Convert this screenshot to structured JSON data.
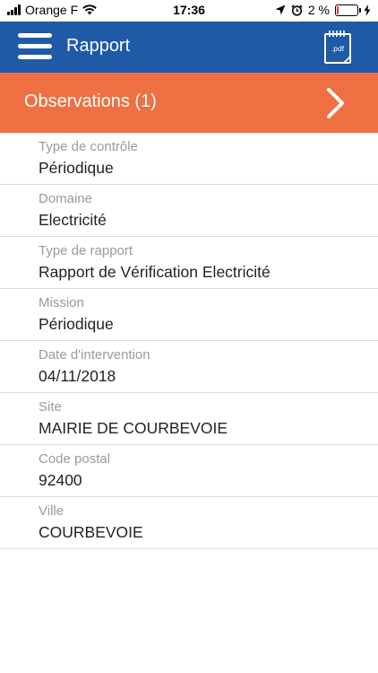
{
  "status_bar": {
    "carrier": "Orange F",
    "time": "17:36",
    "battery_percent": "2 %",
    "battery_level": 0.08,
    "battery_color": "#e53935"
  },
  "header": {
    "title": "Rapport",
    "menu_icon": "hamburger-menu-icon",
    "pdf_icon": "pdf-document-icon",
    "pdf_label": ".pdf",
    "color": "#1f5aa6"
  },
  "observations": {
    "label": "Observations (1)",
    "icon": "chevron-right-icon",
    "color": "#ef7043"
  },
  "details": [
    {
      "label": "Type de contrôle",
      "value": "Périodique"
    },
    {
      "label": "Domaine",
      "value": "Electricité"
    },
    {
      "label": "Type de rapport",
      "value": "Rapport de Vérification Electricité"
    },
    {
      "label": "Mission",
      "value": "Périodique"
    },
    {
      "label": "Date d'intervention",
      "value": "04/11/2018"
    },
    {
      "label": "Site",
      "value": "MAIRIE DE COURBEVOIE"
    },
    {
      "label": "Code postal",
      "value": "92400"
    },
    {
      "label": "Ville",
      "value": "COURBEVOIE"
    }
  ]
}
